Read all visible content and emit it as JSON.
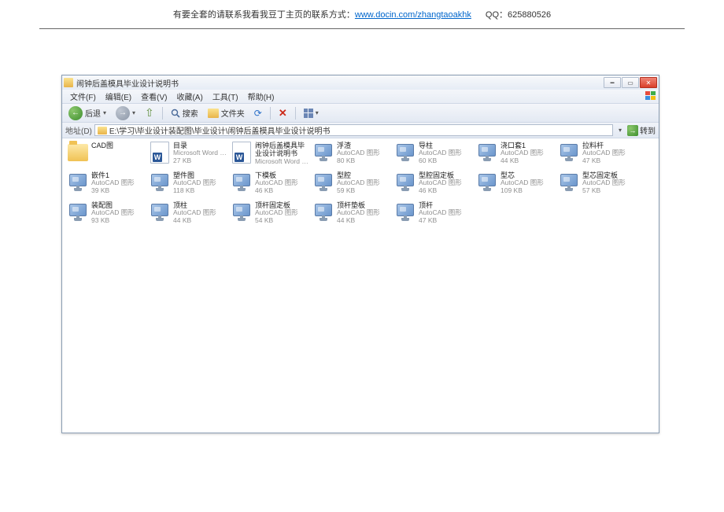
{
  "page_header": {
    "pre_text": "有要全套的请联系我看我豆丁主页的联系方式：",
    "link_text": "www.docin.com/zhangtaoakhk",
    "qq_label": "QQ：625880526"
  },
  "window": {
    "title": "闹钟后盖模具毕业设计说明书",
    "menubar": [
      "文件(F)",
      "编辑(E)",
      "查看(V)",
      "收藏(A)",
      "工具(T)",
      "帮助(H)"
    ],
    "toolbar": {
      "back": "后退",
      "search": "搜索",
      "folders": "文件夹"
    },
    "addressbar": {
      "label": "地址(D)",
      "path": "E:\\学习\\毕业设计装配图\\毕业设计\\闹钟后盖模具毕业设计说明书",
      "go": "转到"
    }
  },
  "files": [
    {
      "icon": "folder",
      "name": "CAD图",
      "sub1": "",
      "sub2": ""
    },
    {
      "icon": "word",
      "name": "目录",
      "sub1": "Microsoft Word 文...",
      "sub2": "27 KB"
    },
    {
      "icon": "word",
      "name": "闹钟后盖模具毕业设计说明书",
      "sub1": "Microsoft Word 文...",
      "sub2": "",
      "wrap": true
    },
    {
      "icon": "dwg",
      "name": "浮渣",
      "sub1": "AutoCAD 图形",
      "sub2": "80 KB"
    },
    {
      "icon": "dwg",
      "name": "导柱",
      "sub1": "AutoCAD 图形",
      "sub2": "60 KB"
    },
    {
      "icon": "dwg",
      "name": "浇口套1",
      "sub1": "AutoCAD 图形",
      "sub2": "44 KB"
    },
    {
      "icon": "dwg",
      "name": "拉料杆",
      "sub1": "AutoCAD 图形",
      "sub2": "47 KB"
    },
    {
      "icon": "dwg",
      "name": "嵌件1",
      "sub1": "AutoCAD 图形",
      "sub2": "39 KB"
    },
    {
      "icon": "dwg",
      "name": "塑件图",
      "sub1": "AutoCAD 图形",
      "sub2": "118 KB"
    },
    {
      "icon": "dwg",
      "name": "下模板",
      "sub1": "AutoCAD 图形",
      "sub2": "46 KB"
    },
    {
      "icon": "dwg",
      "name": "型腔",
      "sub1": "AutoCAD 图形",
      "sub2": "59 KB"
    },
    {
      "icon": "dwg",
      "name": "型腔固定板",
      "sub1": "AutoCAD 图形",
      "sub2": "46 KB"
    },
    {
      "icon": "dwg",
      "name": "型芯",
      "sub1": "AutoCAD 图形",
      "sub2": "109 KB"
    },
    {
      "icon": "dwg",
      "name": "型芯固定板",
      "sub1": "AutoCAD 图形",
      "sub2": "57 KB"
    },
    {
      "icon": "dwg",
      "name": "装配图",
      "sub1": "AutoCAD 图形",
      "sub2": "93 KB"
    },
    {
      "icon": "dwg",
      "name": "顶柱",
      "sub1": "AutoCAD 图形",
      "sub2": "44 KB"
    },
    {
      "icon": "dwg",
      "name": "顶杆固定板",
      "sub1": "AutoCAD 图形",
      "sub2": "54 KB"
    },
    {
      "icon": "dwg",
      "name": "顶杆垫板",
      "sub1": "AutoCAD 图形",
      "sub2": "44 KB"
    },
    {
      "icon": "dwg",
      "name": "顶杆",
      "sub1": "AutoCAD 图形",
      "sub2": "47 KB"
    }
  ]
}
